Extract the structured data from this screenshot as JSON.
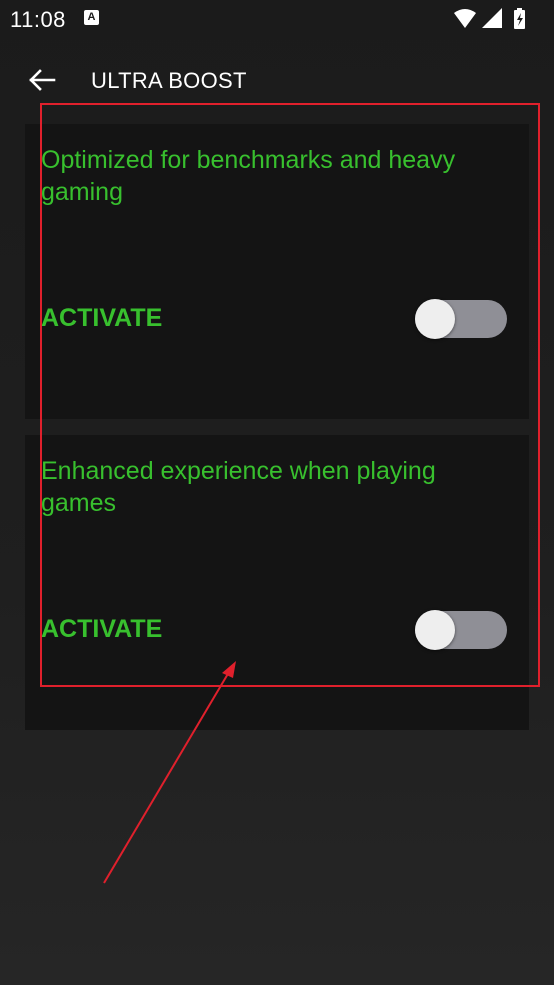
{
  "status_bar": {
    "time": "11:08",
    "notification_icon": "a-icon",
    "icons": [
      "wifi-icon",
      "signal-icon",
      "battery-icon"
    ]
  },
  "app_bar": {
    "title": "ULTRA BOOST",
    "back_icon": "arrow-left-icon"
  },
  "cards": [
    {
      "description": "Optimized for benchmarks and heavy gaming",
      "activate_label": "ACTIVATE",
      "toggle_state": "off"
    },
    {
      "description": "Enhanced experience when playing games",
      "activate_label": "ACTIVATE",
      "toggle_state": "off"
    }
  ],
  "colors": {
    "accent_green": "#38c02e",
    "card_bg": "#141414",
    "annotation_red": "#e0202c",
    "toggle_track": "#8f8f96",
    "toggle_thumb": "#eeeeee"
  }
}
